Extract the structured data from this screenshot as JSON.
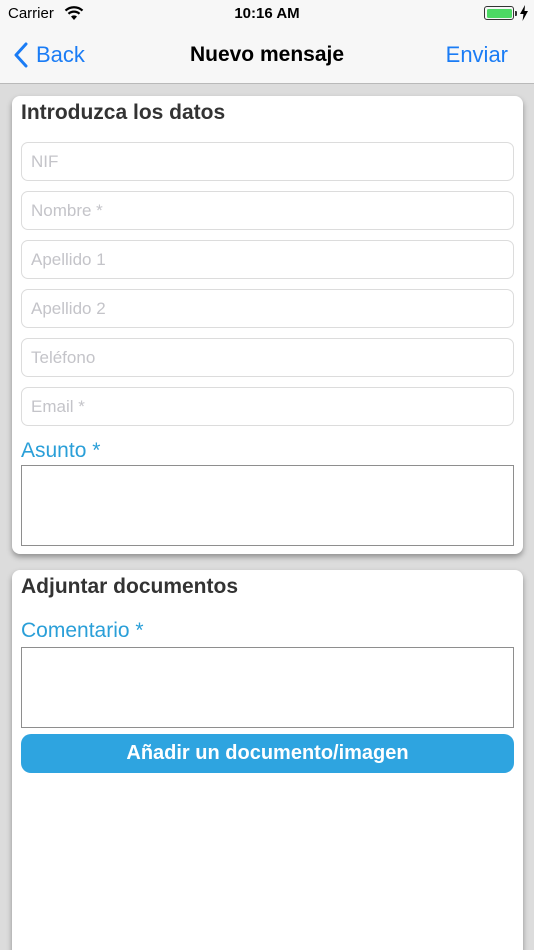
{
  "status_bar": {
    "carrier": "Carrier",
    "time": "10:16 AM",
    "battery_level": 1.0,
    "battery_color": "#4cd964"
  },
  "nav": {
    "back_label": "Back",
    "title": "Nuevo mensaje",
    "send_label": "Enviar",
    "tint_color": "#1a7cf5"
  },
  "personal_data": {
    "title": "Introduzca los datos",
    "fields": [
      {
        "placeholder": "NIF",
        "value": ""
      },
      {
        "placeholder": "Nombre *",
        "value": ""
      },
      {
        "placeholder": "Apellido 1",
        "value": ""
      },
      {
        "placeholder": "Apellido 2",
        "value": ""
      },
      {
        "placeholder": "Teléfono",
        "value": ""
      },
      {
        "placeholder": "Email *",
        "value": ""
      }
    ],
    "subject_label": "Asunto *",
    "subject_value": ""
  },
  "attachments": {
    "title": "Adjuntar documentos",
    "comment_label": "Comentario *",
    "comment_value": "",
    "add_button_label": "Añadir un documento/imagen",
    "accent_color": "#2ea4e0"
  }
}
